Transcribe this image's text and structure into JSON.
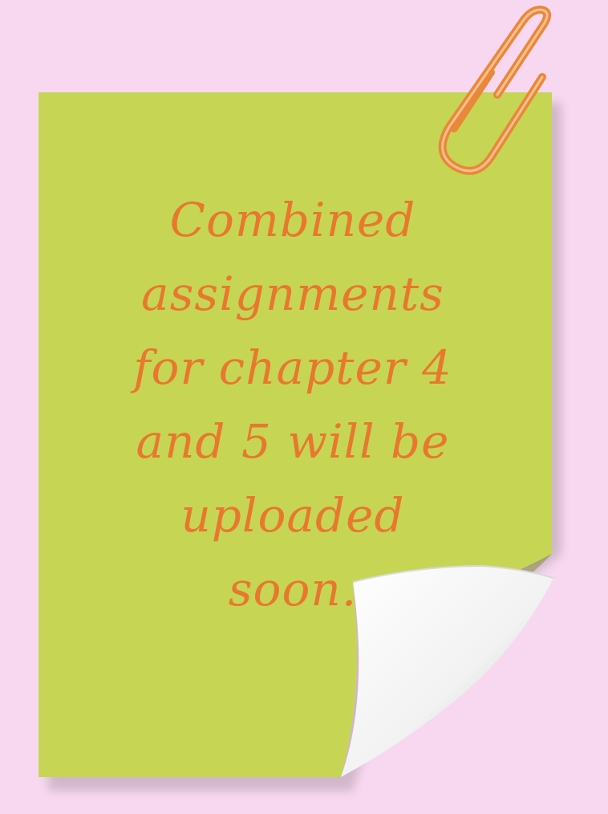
{
  "note": {
    "lines": [
      "Combined",
      "assignments",
      "for chapter 4",
      "and 5 will be",
      "uploaded",
      "soon."
    ]
  },
  "icons": {
    "paperclip": "paperclip-icon",
    "page_curl": "page-curl"
  },
  "colors": {
    "background": "#f8d8f0",
    "note": "#c6d654",
    "text": "#e8782e",
    "paperclip": "#e9883a"
  }
}
